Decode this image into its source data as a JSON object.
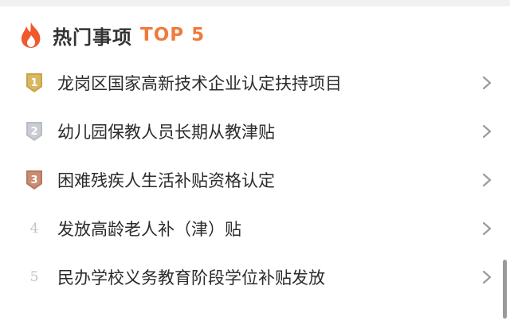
{
  "section": {
    "title": "热门事项",
    "badge": "TOP 5",
    "icon": "flame-icon"
  },
  "items": [
    {
      "rank": "1",
      "label": "龙岗区国家高新技术企业认定扶持项目",
      "medal": "gold"
    },
    {
      "rank": "2",
      "label": "幼儿园保教人员长期从教津贴",
      "medal": "silver"
    },
    {
      "rank": "3",
      "label": "困难残疾人生活补贴资格认定",
      "medal": "bronze"
    },
    {
      "rank": "4",
      "label": "发放高龄老人补（津）贴",
      "medal": ""
    },
    {
      "rank": "5",
      "label": "民办学校义务教育阶段学位补贴发放",
      "medal": ""
    }
  ],
  "colors": {
    "accent": "#f07b3a",
    "flame": "#f0582e",
    "gold": "#c9a24a",
    "silver": "#b9bdc4",
    "bronze": "#b9775f",
    "text": "#2b2b2b",
    "chevron": "#9b9b9b"
  }
}
